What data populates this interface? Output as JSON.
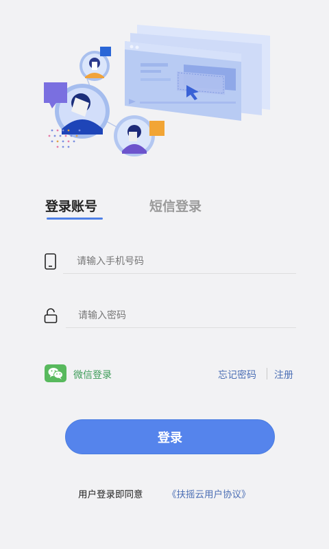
{
  "tabs": {
    "account_login": "登录账号",
    "sms_login": "短信登录"
  },
  "phone": {
    "placeholder": "请输入手机号码",
    "value": ""
  },
  "password": {
    "placeholder": "请输入密码",
    "value": ""
  },
  "wechat_login": "微信登录",
  "links": {
    "forgot_password": "忘记密码",
    "register": "注册"
  },
  "login_button": "登录",
  "agreement": {
    "prefix": "用户登录即同意",
    "link": "《扶摇云用户协议》"
  },
  "icons": {
    "phone": "phone-icon",
    "lock": "lock-icon",
    "wechat": "wechat-icon"
  },
  "colors": {
    "accent": "#5584ec",
    "link": "#4c6fb5",
    "wechat_green": "#58b95d",
    "background": "#f2f2f4"
  }
}
